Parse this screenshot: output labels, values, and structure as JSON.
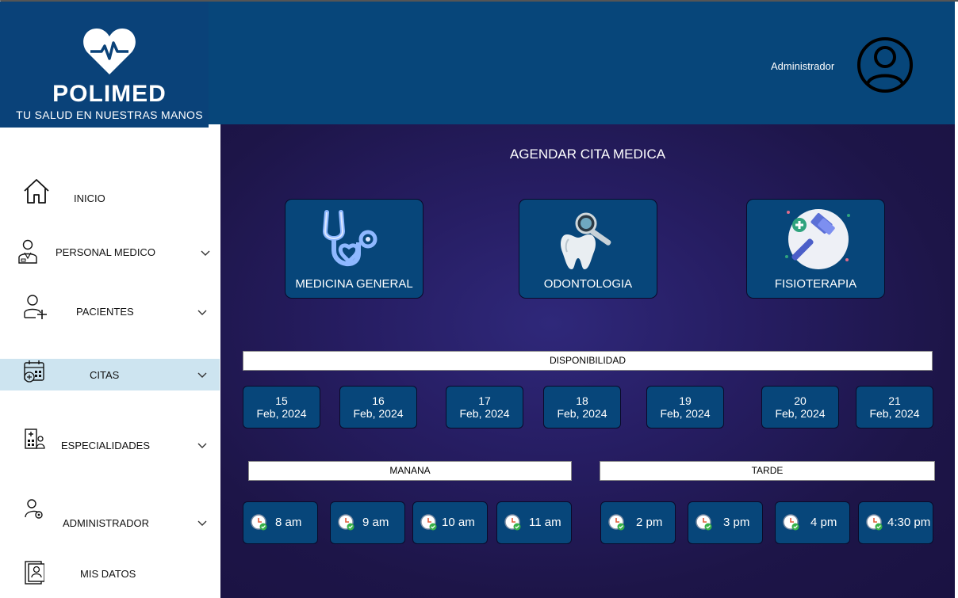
{
  "brand": {
    "name": "POLIMED",
    "tagline": "TU SALUD EN NUESTRAS MANOS"
  },
  "header": {
    "user_label": "Administrador",
    "avatar_icon": "user-circle-icon"
  },
  "sidebar": {
    "items": [
      {
        "label": "INICIO",
        "icon": "home-icon",
        "has_chevron": false
      },
      {
        "label": "PERSONAL MEDICO",
        "icon": "doctor-icon",
        "has_chevron": true
      },
      {
        "label": "PACIENTES",
        "icon": "add-user-icon",
        "has_chevron": true
      },
      {
        "label": "CITAS",
        "icon": "calendar-icon",
        "has_chevron": true,
        "active": true
      },
      {
        "label": "ESPECIALIDADES",
        "icon": "hospital-icon",
        "has_chevron": true
      },
      {
        "label": "ADMINISTRADOR",
        "icon": "user-gear-icon",
        "has_chevron": true
      },
      {
        "label": "MIS DATOS",
        "icon": "id-card-icon",
        "has_chevron": false
      }
    ]
  },
  "main": {
    "title": "AGENDAR CITA MEDICA",
    "specialties": [
      {
        "label": "MEDICINA GENERAL",
        "icon": "stethoscope-icon"
      },
      {
        "label": "ODONTOLOGIA",
        "icon": "tooth-icon"
      },
      {
        "label": "FISIOTERAPIA",
        "icon": "reflex-hammer-icon"
      }
    ],
    "availability_label": "DISPONIBILIDAD",
    "dates": [
      {
        "day": "15",
        "month": "Feb, 2024"
      },
      {
        "day": "16",
        "month": "Feb, 2024"
      },
      {
        "day": "17",
        "month": "Feb, 2024"
      },
      {
        "day": "18",
        "month": "Feb, 2024"
      },
      {
        "day": "19",
        "month": "Feb, 2024"
      },
      {
        "day": "20",
        "month": "Feb, 2024"
      },
      {
        "day": "21",
        "month": "Feb, 2024"
      }
    ],
    "morning_label": "MANANA",
    "afternoon_label": "TARDE",
    "morning_times": [
      "8 am",
      "9 am",
      "10 am",
      "11 am"
    ],
    "afternoon_times": [
      "2 pm",
      "3 pm",
      "4 pm",
      "4:30 pm"
    ],
    "time_icon": "clock-check-icon"
  },
  "colors": {
    "header_bg": "#07467a",
    "panel_bg": "#1d1548",
    "button_bg": "#07467a",
    "active_nav": "#cde4f0"
  }
}
